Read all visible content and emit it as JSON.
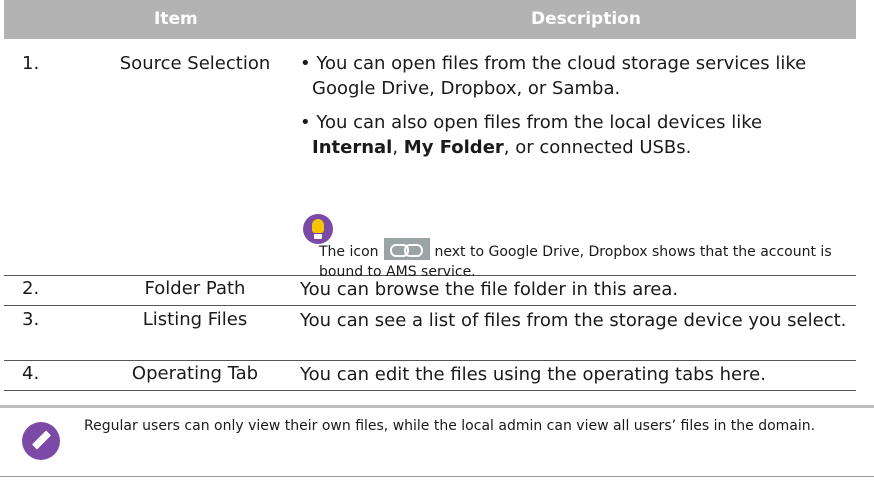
{
  "table": {
    "headers": {
      "item": "Item",
      "description": "Description"
    },
    "rows": [
      {
        "number": "1.",
        "item": "Source Selection",
        "bullet1": "• You can open files from the cloud storage services like Google Drive, Dropbox, or Samba.",
        "bullet2_pre": "• You can also open files from the local devices like ",
        "bullet2_bold1": "Internal",
        "bullet2_mid": ", ",
        "bullet2_bold2": "My Folder",
        "bullet2_post": ", or connected USBs.",
        "tip_pre": "The icon",
        "tip_post": "next to Google Drive, Dropbox shows that the account is bound to AMS service."
      },
      {
        "number": "2.",
        "item": "Folder Path",
        "description": "You can browse the file folder in this area."
      },
      {
        "number": "3.",
        "item": "Listing Files",
        "description": "You can see a list of files from the storage device you select."
      },
      {
        "number": "4.",
        "item": "Operating Tab",
        "description": "You can edit the files using the operating tabs here."
      }
    ]
  },
  "note": {
    "text": "Regular users can only view their own files, while the local admin can view all users’ files in the domain."
  },
  "icons": {
    "tip": "lightbulb-icon",
    "link": "link-icon",
    "note": "pencil-icon"
  },
  "colors": {
    "header_bg": "#b3b3b3",
    "icon_purple": "#7b4aa6"
  }
}
